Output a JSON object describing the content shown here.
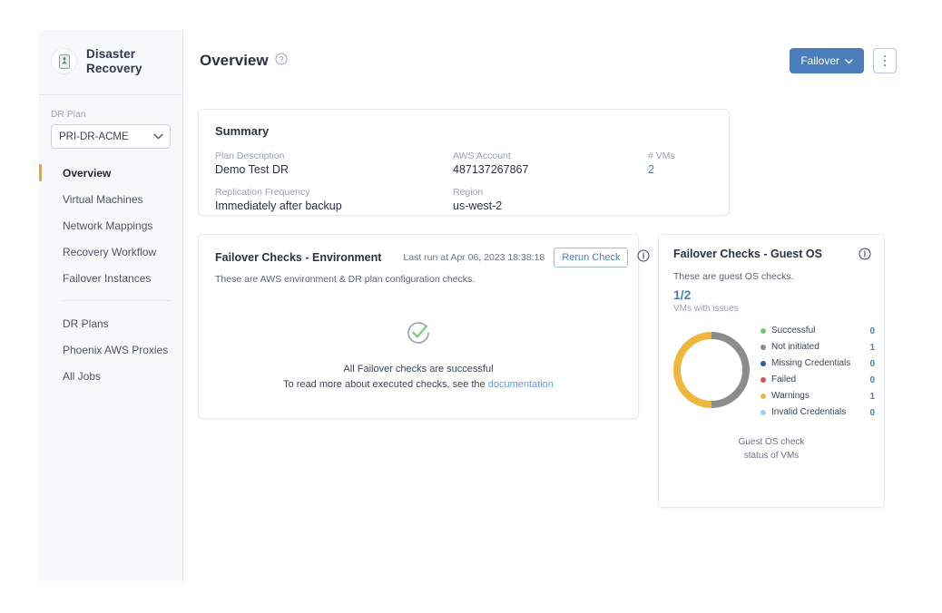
{
  "sidebar": {
    "brand": {
      "line1": "Disaster",
      "line2": "Recovery",
      "logo_icon": "device-icon"
    },
    "drplan": {
      "label": "DR Plan",
      "selected": "PRI-DR-ACME",
      "caret_icon": "chevron-down-icon",
      "options": [
        "PRI-DR-ACME"
      ]
    },
    "items": [
      {
        "label": "Overview",
        "active": true
      },
      {
        "label": "Virtual Machines",
        "active": false
      },
      {
        "label": "Network Mappings",
        "active": false
      },
      {
        "label": "Recovery Workflow",
        "active": false
      },
      {
        "label": "Failover Instances",
        "active": false
      }
    ],
    "items2": [
      {
        "label": "DR Plans"
      },
      {
        "label": "Phoenix AWS Proxies"
      },
      {
        "label": "All Jobs"
      }
    ],
    "active_indicator_color": "#f0a22e"
  },
  "header": {
    "title": "Overview",
    "help_icon": "help-circle-icon",
    "failover_label": "Failover",
    "failover_caret_icon": "chevron-down-icon",
    "kebab_icon": "more-vertical-icon",
    "primary_color": "#4a7ebb"
  },
  "summary": {
    "title": "Summary",
    "fields": [
      {
        "label": "Plan Description",
        "value": "Demo Test DR",
        "link": false
      },
      {
        "label": "AWS Account",
        "value": "487137267867",
        "link": false
      },
      {
        "label": "# VMs",
        "value": "2",
        "link": true
      },
      {
        "label": "Replication Frequency",
        "value": "Immediately after backup",
        "link": false
      },
      {
        "label": "Region",
        "value": "us-west-2",
        "link": false
      }
    ]
  },
  "env_card": {
    "title": "Failover Checks - Environment",
    "last_run": "Last run at Apr 06, 2023 18:38:18",
    "rerun_label": "Rerun Check",
    "info_icon": "info-circle-icon",
    "subtitle": "These are AWS environment & DR plan configuration checks.",
    "status_icon": "check-circle-icon",
    "status_color": "#7cc47f",
    "message_line1": "All Failover checks are successful",
    "message_line2": "To read more about executed checks, see the",
    "message_link": "documentation"
  },
  "guest_card": {
    "title": "Failover Checks - Guest OS",
    "info_icon": "info-circle-icon",
    "subtitle": "These are guest OS checks.",
    "count": "1/2",
    "count_label": "VMs with issues",
    "caption_line1": "Guest OS check",
    "caption_line2": "status of VMs"
  },
  "chart_data": {
    "type": "pie",
    "title": "Guest OS check status of VMs",
    "categories": [
      "Successful",
      "Not initiated",
      "Missing Credentials",
      "Failed",
      "Warnings",
      "Invalid Credentials"
    ],
    "values": [
      0,
      1,
      0,
      0,
      1,
      0
    ],
    "colors": [
      "#7cc47f",
      "#8c8c8c",
      "#2e5fa3",
      "#d9534f",
      "#efb53c",
      "#a8cdeb"
    ],
    "legend_position": "right",
    "donut": true,
    "total": 2
  }
}
